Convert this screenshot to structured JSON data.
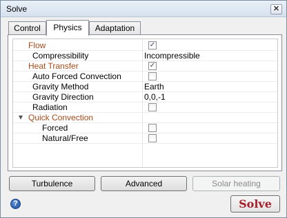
{
  "window": {
    "title": "Solve",
    "close_glyph": "✕"
  },
  "tabs": [
    {
      "label": "Control"
    },
    {
      "label": "Physics"
    },
    {
      "label": "Adaptation"
    }
  ],
  "properties": [
    {
      "name": "Flow",
      "type": "category",
      "checked": true
    },
    {
      "name": "Compressibility",
      "type": "value",
      "value": "Incompressible"
    },
    {
      "name": "Heat Transfer",
      "type": "category",
      "checked": true
    },
    {
      "name": "Auto Forced Convection",
      "type": "check",
      "checked": false
    },
    {
      "name": "Gravity Method",
      "type": "value",
      "value": "Earth"
    },
    {
      "name": "Gravity Direction",
      "type": "value",
      "value": "0,0,-1"
    },
    {
      "name": "Radiation",
      "type": "check",
      "checked": false
    },
    {
      "name": "Quick Convection",
      "type": "category-expandable"
    },
    {
      "name": "Forced",
      "type": "check",
      "checked": false
    },
    {
      "name": "Natural/Free",
      "type": "check",
      "checked": false
    }
  ],
  "buttons": {
    "turbulence": "Turbulence",
    "advanced": "Advanced",
    "solar_heating": "Solar heating",
    "solve": "Solve"
  },
  "icons": {
    "help": "help-icon",
    "help_glyph": "?",
    "checkmark": "✓"
  },
  "colors": {
    "category_text": "#a44a1a",
    "solve_text": "#a4202a"
  }
}
